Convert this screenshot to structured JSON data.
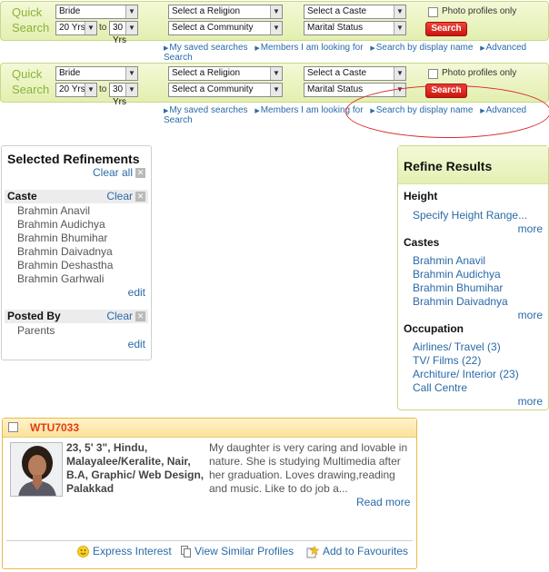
{
  "quick_search": {
    "title_line1": "Quick",
    "title_line2": "Search",
    "marital_default": "Bride",
    "religion_placeholder": "Select a Religion",
    "caste_placeholder": "Select a Caste",
    "community_placeholder": "Select a Community",
    "marital_status_placeholder": "Marital Status",
    "age_from": "20 Yrs",
    "age_to": "30 Yrs",
    "to_label": "to",
    "photo_only_label": "Photo profiles only",
    "search_label": "Search",
    "links": [
      "My saved searches",
      "Members I am looking for",
      "Search by display name",
      "Advanced Search"
    ]
  },
  "selected_refinements": {
    "title": "Selected Refinements",
    "clear_all": "Clear all",
    "caste_label": "Caste",
    "clear": "Clear",
    "castes": [
      "Brahmin Anavil",
      "Brahmin Audichya",
      "Brahmin Bhumihar",
      "Brahmin Daivadnya",
      "Brahmin Deshastha",
      "Brahmin Garhwali"
    ],
    "edit": "edit",
    "posted_by_label": "Posted By",
    "posted_by": [
      "Parents"
    ]
  },
  "refine_results": {
    "title": "Refine Results",
    "height_label": "Height",
    "height_link": "Specify Height Range...",
    "castes_label": "Castes",
    "castes": [
      "Brahmin Anavil",
      "Brahmin Audichya",
      "Brahmin Bhumihar",
      "Brahmin Daivadnya"
    ],
    "occupation_label": "Occupation",
    "occupations": [
      "Airlines/ Travel (3)",
      "TV/ Films (22)",
      "Architure/ Interior (23)",
      "Call Centre"
    ],
    "more": "more"
  },
  "profile": {
    "id": "WTU7033",
    "stats": "23, 5' 3\", Hindu, Malayalee/Keralite, Nair, B.A, Graphic/ Web Design, Palakkad",
    "description": "My daughter is very caring and lovable in nature. She is studying Multimedia after her graduation. Loves drawing,reading and music. Like to do job a...",
    "read_more": "Read more",
    "express_interest": "Express Interest",
    "view_similar": "View Similar Profiles",
    "add_favourites": "Add to Favourites"
  },
  "colors": {
    "accent_green": "#8cb23c",
    "link_blue": "#2a6aa8",
    "search_red": "#d9281a",
    "id_orange": "#e53b12"
  }
}
